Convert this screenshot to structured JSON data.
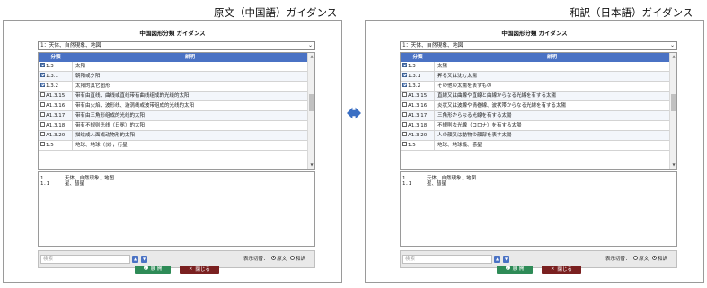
{
  "captions": {
    "left": "原文（中国語）ガイダンス",
    "right": "和訳（日本語）ガイダンス"
  },
  "colors": {
    "header_blue": "#4a72c4",
    "expand_green": "#2e8b57",
    "close_red": "#7a2020",
    "arrow_blue": "#3a6fc4"
  },
  "left_panel": {
    "title": "中国図形分類 ガイダンス",
    "select_value": "1：天体、自然現象、地図",
    "columns": {
      "code": "分類",
      "desc": "説明"
    },
    "rows": [
      {
        "code": "1.3",
        "checked": true,
        "desc": "太阳"
      },
      {
        "code": "1.3.1",
        "checked": true,
        "desc": "朝阳或夕阳"
      },
      {
        "code": "1.3.2",
        "checked": true,
        "desc": "太阳的其它图形"
      },
      {
        "code": "A1.3.15",
        "checked": false,
        "desc": "带有由直线、曲线或直线带有曲线组成的光线的太阳"
      },
      {
        "code": "A1.3.16",
        "checked": false,
        "desc": "带有由火焰、波形线、漩涡线或波带组成的光线的太阳"
      },
      {
        "code": "A1.3.17",
        "checked": false,
        "desc": "带有由三角形组成的光线的太阳"
      },
      {
        "code": "A1.3.18",
        "checked": false,
        "desc": "带有不规则光线（日冕）的太阳"
      },
      {
        "code": "A1.3.20",
        "checked": false,
        "desc": "描绘成人面或动物形的太阳"
      },
      {
        "code": "1.5",
        "checked": false,
        "desc": "地球、地球（仪），行星"
      }
    ],
    "text_lines": [
      {
        "code": "1",
        "text": "天体、自然现象、地图"
      },
      {
        "code": "1.1",
        "text": "星、彗星"
      }
    ],
    "search_placeholder": "検索",
    "toggle_label": "表示切替：",
    "option_original": "原文",
    "option_translation": "和訳",
    "selected_option": "original",
    "expand_label": "展 開",
    "close_label": "閉じる"
  },
  "right_panel": {
    "title": "中国図形分類 ガイダンス",
    "select_value": "1：天体、自然現象、地図",
    "columns": {
      "code": "分類",
      "desc": "説明"
    },
    "rows": [
      {
        "code": "1.3",
        "checked": true,
        "desc": "太陽"
      },
      {
        "code": "1.3.1",
        "checked": true,
        "desc": "昇る又は沈む太陽"
      },
      {
        "code": "1.3.2",
        "checked": true,
        "desc": "その他の太陽を表すもの"
      },
      {
        "code": "A1.3.15",
        "checked": false,
        "desc": "直線又は曲線や直線と曲線からなる光線を有する太陽"
      },
      {
        "code": "A1.3.16",
        "checked": false,
        "desc": "炎状又は波線や渦巻線、波状帯からなる光線を有する太陽"
      },
      {
        "code": "A1.3.17",
        "checked": false,
        "desc": "三角形からなる光線を有する太陽"
      },
      {
        "code": "A1.3.18",
        "checked": false,
        "desc": "不規則な光線（コロナ）を有する太陽"
      },
      {
        "code": "A1.3.20",
        "checked": false,
        "desc": "人の顔又は動物の顔部を表す太陽"
      },
      {
        "code": "1.5",
        "checked": false,
        "desc": "地球、地球儀、惑星"
      }
    ],
    "text_lines": [
      {
        "code": "1",
        "text": "天体、自然現象、地図"
      },
      {
        "code": "1.1",
        "text": "星、彗星"
      }
    ],
    "search_placeholder": "検索",
    "toggle_label": "表示切替：",
    "option_original": "原文",
    "option_translation": "和訳",
    "selected_option": "translation",
    "expand_label": "展 開",
    "close_label": "閉じる"
  }
}
